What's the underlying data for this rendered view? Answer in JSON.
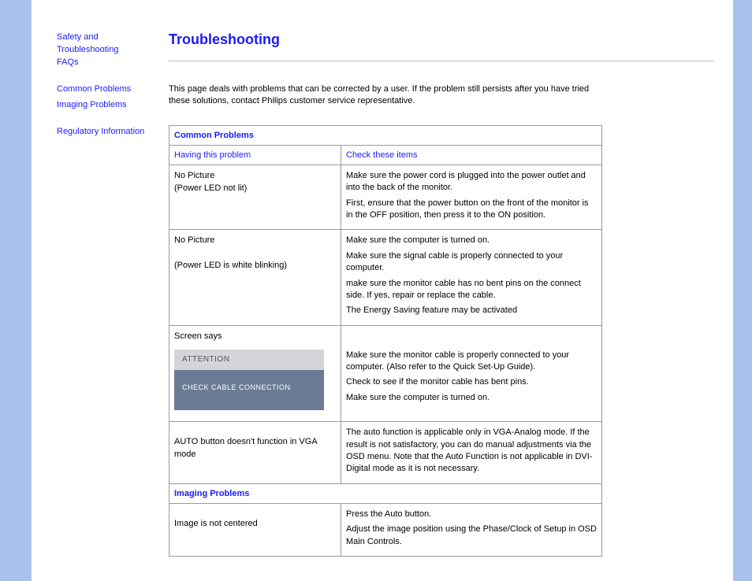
{
  "sidebar": {
    "group1": {
      "line1": "Safety and",
      "line2": "Troubleshooting",
      "line3": "FAQs"
    },
    "common": "Common Problems",
    "imaging": "Imaging Problems",
    "regulatory": "Regulatory Information"
  },
  "title": "Troubleshooting",
  "intro": "This page deals with problems that can be corrected by a user. If the problem still persists after you have tried these solutions, contact Philips customer service representative.",
  "table": {
    "section1": "Common Problems",
    "colA": "Having this problem",
    "colB": "Check these items",
    "rows": [
      {
        "problemA": "No Picture",
        "problemB": "(Power LED not lit)",
        "sol1": "Make sure the power cord is plugged into the power outlet and into the back of the monitor.",
        "sol2": "First, ensure that the power button on the front of the monitor is in the OFF position, then press it to the ON position."
      },
      {
        "problemA": "No Picture",
        "problemB": "(Power LED is white blinking)",
        "sol1": "Make sure the computer is turned on.",
        "sol2": "Make sure the signal cable is properly connected to your computer.",
        "sol3": "make sure the monitor cable has no bent pins on the connect side. If yes, repair or replace the cable.",
        "sol4": "The Energy Saving feature may be activated"
      },
      {
        "problemA": "Screen says",
        "box_attn": "ATTENTION",
        "box_msg": "CHECK CABLE CONNECTION",
        "sol1": "Make sure the monitor cable is properly connected to your computer. (Also refer to the Quick Set-Up Guide).",
        "sol2": "Check to see if the monitor cable has bent pins.",
        "sol3": "Make sure the computer is turned on."
      },
      {
        "problemA": "AUTO button doesn't function in VGA mode",
        "sol1": "The auto function is applicable only in VGA-Analog mode.  If the result is not satisfactory, you can do manual adjustments via the OSD menu.  Note that the Auto Function is not applicable in DVI-Digital mode as it is not necessary."
      }
    ],
    "section2": "Imaging Problems",
    "rows2": [
      {
        "problemA": "Image is not centered",
        "sol1": "Press the Auto button.",
        "sol2": "Adjust the image position using the Phase/Clock of Setup in OSD Main Controls."
      }
    ]
  }
}
